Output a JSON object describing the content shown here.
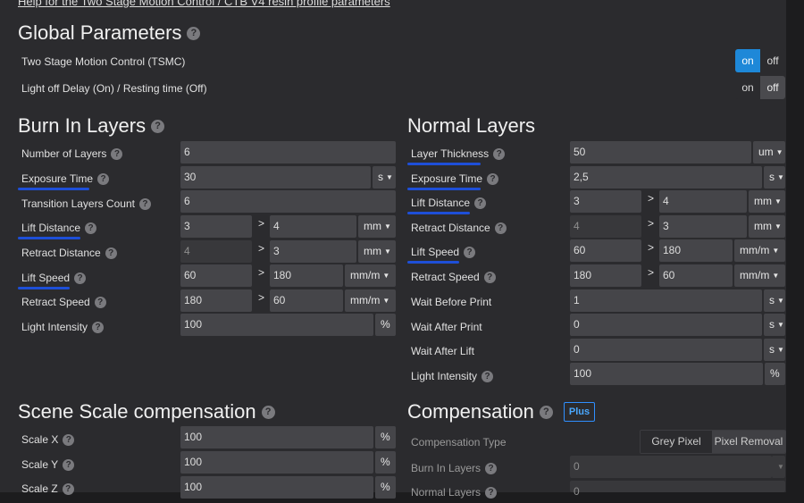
{
  "help_link": "Help for the Two Stage Motion Control / CTB V4 resin profile parameters",
  "global": {
    "title": "Global Parameters",
    "tsmc_label": "Two Stage Motion Control (TSMC)",
    "light_off_label": "Light off Delay (On) / Resting time (Off)",
    "on": "on",
    "off": "off"
  },
  "burn": {
    "title": "Burn In Layers",
    "number_of_layers": {
      "label": "Number of Layers",
      "value": "6"
    },
    "exposure_time": {
      "label": "Exposure Time",
      "value": "30",
      "unit": "s"
    },
    "transition_layers": {
      "label": "Transition Layers Count",
      "value": "6"
    },
    "lift_distance": {
      "label": "Lift Distance",
      "v1": "3",
      "v2": "4",
      "unit": "mm"
    },
    "retract_distance": {
      "label": "Retract Distance",
      "v1": "4",
      "v2": "3",
      "unit": "mm"
    },
    "lift_speed": {
      "label": "Lift Speed",
      "v1": "60",
      "v2": "180",
      "unit": "mm/m"
    },
    "retract_speed": {
      "label": "Retract Speed",
      "v1": "180",
      "v2": "60",
      "unit": "mm/m"
    },
    "light_intensity": {
      "label": "Light Intensity",
      "value": "100",
      "unit": "%"
    }
  },
  "normal": {
    "title": "Normal Layers",
    "layer_thickness": {
      "label": "Layer Thickness",
      "value": "50",
      "unit": "um"
    },
    "exposure_time": {
      "label": "Exposure Time",
      "value": "2,5",
      "unit": "s"
    },
    "lift_distance": {
      "label": "Lift Distance",
      "v1": "3",
      "v2": "4",
      "unit": "mm"
    },
    "retract_distance": {
      "label": "Retract Distance",
      "v1": "4",
      "v2": "3",
      "unit": "mm"
    },
    "lift_speed": {
      "label": "Lift Speed",
      "v1": "60",
      "v2": "180",
      "unit": "mm/m"
    },
    "retract_speed": {
      "label": "Retract Speed",
      "v1": "180",
      "v2": "60",
      "unit": "mm/m"
    },
    "wait_before_print": {
      "label": "Wait Before Print",
      "value": "1",
      "unit": "s"
    },
    "wait_after_print": {
      "label": "Wait After Print",
      "value": "0",
      "unit": "s"
    },
    "wait_after_lift": {
      "label": "Wait After Lift",
      "value": "0",
      "unit": "s"
    },
    "light_intensity": {
      "label": "Light Intensity",
      "value": "100",
      "unit": "%"
    }
  },
  "scene": {
    "title": "Scene Scale compensation",
    "scale_x": {
      "label": "Scale X",
      "value": "100",
      "unit": "%"
    },
    "scale_y": {
      "label": "Scale Y",
      "value": "100",
      "unit": "%"
    },
    "scale_z": {
      "label": "Scale Z",
      "value": "100",
      "unit": "%"
    }
  },
  "compensation": {
    "title": "Compensation",
    "plus": "Plus",
    "type_label": "Compensation Type",
    "grey_pixel": "Grey Pixel",
    "pixel_removal": "Pixel Removal",
    "burn_in_label": "Burn In Layers",
    "burn_in_value": "0",
    "normal_label": "Normal Layers",
    "normal_value": "0"
  },
  "gt": ">",
  "q": "?"
}
